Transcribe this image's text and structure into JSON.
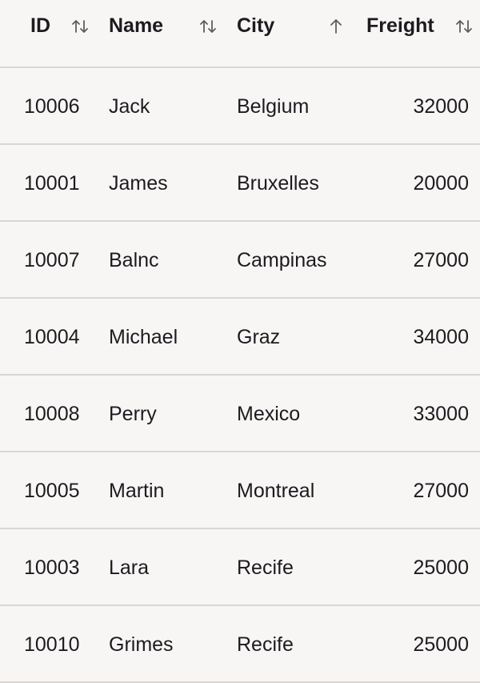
{
  "columns": {
    "id": {
      "label": "ID",
      "sort_icon": "sort-both-icon"
    },
    "name": {
      "label": "Name",
      "sort_icon": "sort-both-icon"
    },
    "city": {
      "label": "City",
      "sort_icon": "sort-ascending-icon"
    },
    "freight": {
      "label": "Freight",
      "sort_icon": "sort-both-icon"
    }
  },
  "rows": [
    {
      "id": "10006",
      "name": "Jack",
      "city": "Belgium",
      "freight": "32000"
    },
    {
      "id": "10001",
      "name": "James",
      "city": "Bruxelles",
      "freight": "20000"
    },
    {
      "id": "10007",
      "name": "Balnc",
      "city": "Campinas",
      "freight": "27000"
    },
    {
      "id": "10004",
      "name": "Michael",
      "city": "Graz",
      "freight": "34000"
    },
    {
      "id": "10008",
      "name": "Perry",
      "city": "Mexico",
      "freight": "33000"
    },
    {
      "id": "10005",
      "name": "Martin",
      "city": "Montreal",
      "freight": "27000"
    },
    {
      "id": "10003",
      "name": "Lara",
      "city": "Recife",
      "freight": "25000"
    },
    {
      "id": "10010",
      "name": "Grimes",
      "city": "Recife",
      "freight": "25000"
    }
  ],
  "colors": {
    "background": "#f8f6f5",
    "text": "#1c1b1f",
    "divider": "#d9d6d4",
    "icon": "#5f5d62"
  }
}
